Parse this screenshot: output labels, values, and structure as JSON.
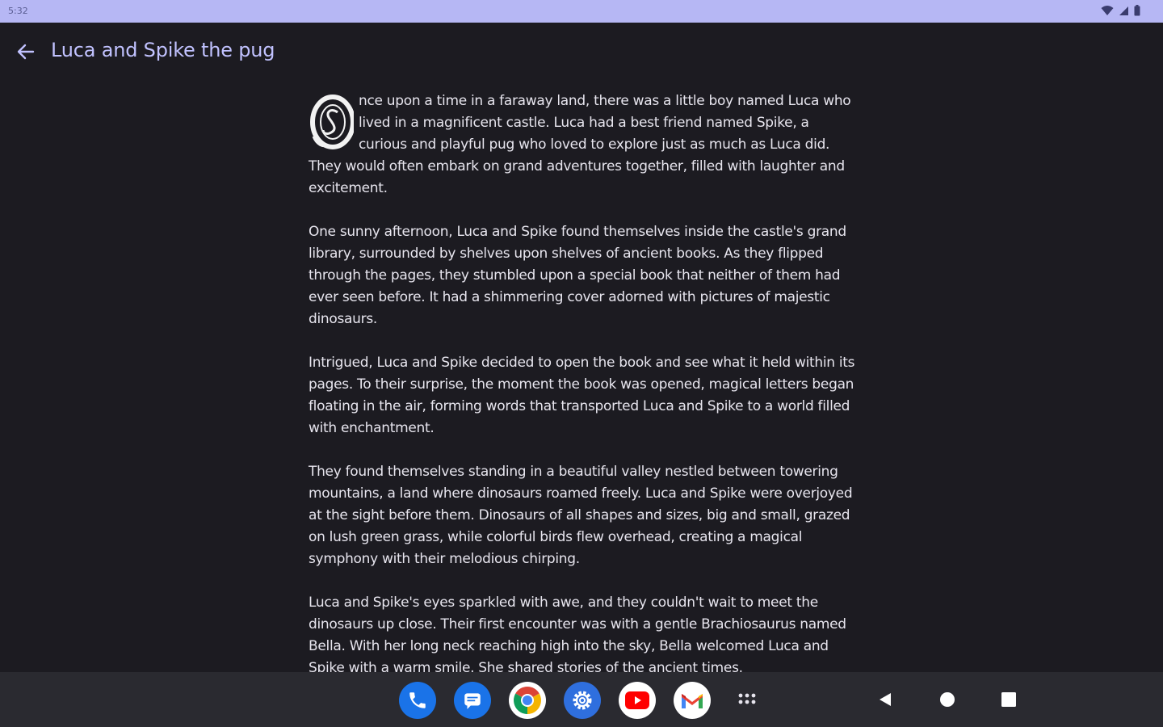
{
  "status_bar": {
    "time": "5:32",
    "icons": [
      "wifi-icon",
      "cellular-signal-icon",
      "battery-icon"
    ]
  },
  "app_bar": {
    "back_icon": "arrow-back-icon",
    "title": "Luca and Spike the pug"
  },
  "story": {
    "drop_cap_letter": "O",
    "paragraphs": [
      "nce upon a time in a faraway land, there was a little boy named Luca who lived in a magnificent castle. Luca had a best friend named Spike, a curious and playful pug who loved to explore just as much as Luca did. They would often embark on grand adventures together, filled with laughter and excitement.",
      "One sunny afternoon, Luca and Spike found themselves inside the castle's grand library, surrounded by shelves upon shelves of ancient books. As they flipped through the pages, they stumbled upon a special book that neither of them had ever seen before. It had a shimmering cover adorned with pictures of majestic dinosaurs.",
      "Intrigued, Luca and Spike decided to open the book and see what it held within its pages. To their surprise, the moment the book was opened, magical letters began floating in the air, forming words that transported Luca and Spike to a world filled with enchantment.",
      "They found themselves standing in a beautiful valley nestled between towering mountains, a land where dinosaurs roamed freely. Luca and Spike were overjoyed at the sight before them. Dinosaurs of all shapes and sizes, big and small, grazed on lush green grass, while colorful birds flew overhead, creating a magical symphony with their melodious chirping.",
      "Luca and Spike's eyes sparkled with awe, and they couldn't wait to meet the dinosaurs up close. Their first encounter was with a gentle Brachiosaurus named Bella. With her long neck reaching high into the sky, Bella welcomed Luca and Spike with a warm smile. She shared stories of the ancient times."
    ]
  },
  "taskbar": {
    "apps": [
      {
        "name": "phone",
        "icon": "phone-icon",
        "color": "#1a73e8"
      },
      {
        "name": "messages",
        "icon": "messages-icon",
        "color": "#1a73e8"
      },
      {
        "name": "chrome",
        "icon": "chrome-icon",
        "color": "#ffffff"
      },
      {
        "name": "settings",
        "icon": "settings-icon",
        "color": "#2f6fde"
      },
      {
        "name": "youtube",
        "icon": "youtube-icon",
        "color": "#ffffff"
      },
      {
        "name": "gmail",
        "icon": "gmail-icon",
        "color": "#ffffff"
      },
      {
        "name": "all-apps",
        "icon": "app-grid-icon",
        "color": "#2a2a30"
      }
    ],
    "nav": [
      "back-triangle-icon",
      "home-circle-icon",
      "recents-square-icon"
    ]
  },
  "colors": {
    "status_bar": "#b6b7f4",
    "background": "#1c1b21",
    "title": "#c1c2ff",
    "text": "#e7e5ee",
    "taskbar": "#2a2a30"
  }
}
